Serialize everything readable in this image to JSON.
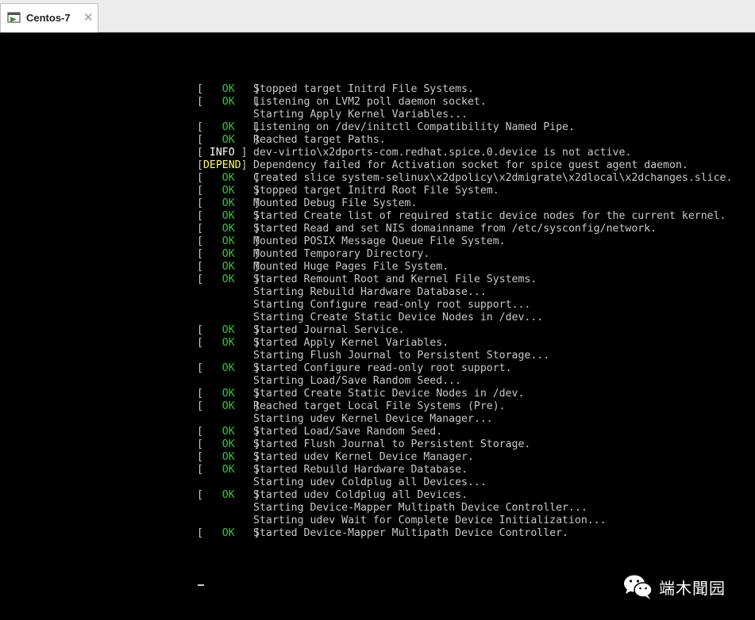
{
  "window": {
    "tab_title": "Centos-7",
    "close_glyph": "✕",
    "tab_icon": "vm-console-icon"
  },
  "console": {
    "lines": [
      {
        "status": "OK",
        "text": "Stopped target Initrd File Systems."
      },
      {
        "status": "OK",
        "text": "Listening on LVM2 poll daemon socket."
      },
      {
        "status": "",
        "text": "Starting Apply Kernel Variables..."
      },
      {
        "status": "OK",
        "text": "Listening on /dev/initctl Compatibility Named Pipe."
      },
      {
        "status": "OK",
        "text": "Reached target Paths."
      },
      {
        "status": "INFO",
        "text": "dev-virtio\\x2dports-com.redhat.spice.0.device is not active."
      },
      {
        "status": "DEPEND",
        "text": "Dependency failed for Activation socket for spice guest agent daemon."
      },
      {
        "status": "OK",
        "text": "Created slice system-selinux\\x2dpolicy\\x2dmigrate\\x2dlocal\\x2dchanges.slice."
      },
      {
        "status": "OK",
        "text": "Stopped target Initrd Root File System."
      },
      {
        "status": "OK",
        "text": "Mounted Debug File System."
      },
      {
        "status": "OK",
        "text": "Started Create list of required static device nodes for the current kernel."
      },
      {
        "status": "OK",
        "text": "Started Read and set NIS domainname from /etc/sysconfig/network."
      },
      {
        "status": "OK",
        "text": "Mounted POSIX Message Queue File System."
      },
      {
        "status": "OK",
        "text": "Mounted Temporary Directory."
      },
      {
        "status": "OK",
        "text": "Mounted Huge Pages File System."
      },
      {
        "status": "OK",
        "text": "Started Remount Root and Kernel File Systems."
      },
      {
        "status": "",
        "text": "Starting Rebuild Hardware Database..."
      },
      {
        "status": "",
        "text": "Starting Configure read-only root support..."
      },
      {
        "status": "",
        "text": "Starting Create Static Device Nodes in /dev..."
      },
      {
        "status": "OK",
        "text": "Started Journal Service."
      },
      {
        "status": "OK",
        "text": "Started Apply Kernel Variables."
      },
      {
        "status": "",
        "text": "Starting Flush Journal to Persistent Storage..."
      },
      {
        "status": "OK",
        "text": "Started Configure read-only root support."
      },
      {
        "status": "",
        "text": "Starting Load/Save Random Seed..."
      },
      {
        "status": "OK",
        "text": "Started Create Static Device Nodes in /dev."
      },
      {
        "status": "OK",
        "text": "Reached target Local File Systems (Pre)."
      },
      {
        "status": "",
        "text": "Starting udev Kernel Device Manager..."
      },
      {
        "status": "OK",
        "text": "Started Load/Save Random Seed."
      },
      {
        "status": "OK",
        "text": "Started Flush Journal to Persistent Storage."
      },
      {
        "status": "OK",
        "text": "Started udev Kernel Device Manager."
      },
      {
        "status": "OK",
        "text": "Started Rebuild Hardware Database."
      },
      {
        "status": "",
        "text": "Starting udev Coldplug all Devices..."
      },
      {
        "status": "OK",
        "text": "Started udev Coldplug all Devices."
      },
      {
        "status": "",
        "text": "Starting Device-Mapper Multipath Device Controller..."
      },
      {
        "status": "",
        "text": "Starting udev Wait for Complete Device Initialization..."
      },
      {
        "status": "OK",
        "text": "Started Device-Mapper Multipath Device Controller."
      }
    ]
  },
  "watermark": {
    "text": "端木聞园",
    "icon": "wechat-icon"
  },
  "colors": {
    "ok": "#3ec23e",
    "info": "#ffffff",
    "depend": "#ffff55",
    "text": "#c8c8c8",
    "background": "#000000"
  }
}
